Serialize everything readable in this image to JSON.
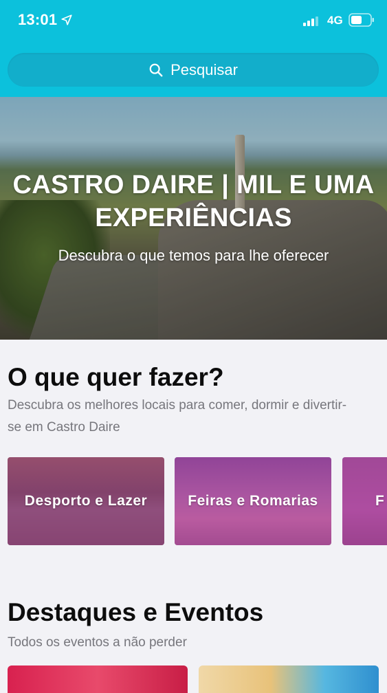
{
  "status_bar": {
    "time": "13:01",
    "network": "4G",
    "icons": [
      "location-arrow-icon",
      "signal-bars-icon",
      "battery-icon"
    ]
  },
  "search": {
    "label": "Pesquisar",
    "icon": "search-icon"
  },
  "hero": {
    "title": "CASTRO DAIRE | MIL E UMA EXPERIÊNCIAS",
    "subtitle": "Descubra o que temos para lhe oferecer"
  },
  "section_activities": {
    "title": "O que quer fazer?",
    "subtitle": "Descubra os melhores locais para comer, dormir e divertir-se em Castro Daire",
    "cards": [
      {
        "label": "Desporto e Lazer"
      },
      {
        "label": "Feiras e Romarias"
      },
      {
        "label": "F"
      }
    ]
  },
  "section_events": {
    "title": "Destaques e Eventos",
    "subtitle": "Todos os eventos a não perder"
  },
  "colors": {
    "header": "#0cc1dc",
    "search_bg": "#12aecb",
    "background": "#f2f2f6",
    "card_overlay": "#b02496"
  }
}
